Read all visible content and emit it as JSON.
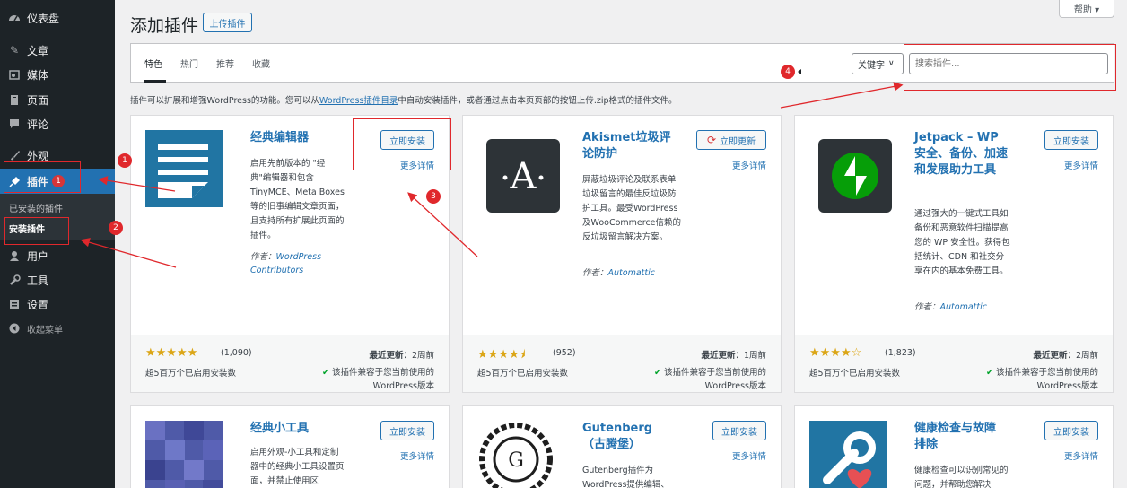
{
  "sidebar": {
    "items": [
      {
        "label": "仪表盘",
        "icon": "dashboard-icon"
      },
      {
        "label": "文章",
        "icon": "pin-icon"
      },
      {
        "label": "媒体",
        "icon": "media-icon"
      },
      {
        "label": "页面",
        "icon": "page-icon"
      },
      {
        "label": "评论",
        "icon": "comment-icon"
      },
      {
        "label": "外观",
        "icon": "brush-icon"
      },
      {
        "label": "插件",
        "icon": "plugin-icon"
      },
      {
        "label": "用户",
        "icon": "user-icon"
      },
      {
        "label": "工具",
        "icon": "wrench-icon"
      },
      {
        "label": "设置",
        "icon": "settings-icon"
      },
      {
        "label": "收起菜单",
        "icon": "collapse-icon"
      }
    ],
    "sub_items": [
      {
        "label": "已安装的插件"
      },
      {
        "label": "安装插件"
      }
    ]
  },
  "header": {
    "title": "添加插件",
    "upload_label": "上传插件",
    "help_label": "帮助 ▾"
  },
  "filters": {
    "tabs": [
      "特色",
      "热门",
      "推荐",
      "收藏"
    ],
    "keyword_label": "关键字",
    "search_placeholder": "搜索插件..."
  },
  "intro": {
    "before": "插件可以扩展和增强WordPress的功能。您可以从",
    "link": "WordPress插件目录",
    "after": "中自动安装插件，或者通过点击本页页部的按钮上传.zip格式的插件文件。"
  },
  "cards": [
    {
      "name": "经典编辑器",
      "button": "立即安装",
      "more": "更多详情",
      "desc": "启用先前版本的 \"经典\"编辑器和包含TinyMCE、Meta Boxes等的旧事编辑文章页面，且支持所有扩展此页面的插件。",
      "author_prefix": "作者：",
      "author": "WordPress Contributors",
      "stars": "★★★★★",
      "rating_count": "(1,090)",
      "installs": "超5百万个已启用安装数",
      "updated_label": "最近更新：",
      "updated": "2周前",
      "compat_check": "✔",
      "compat_strong": "该插件兼容于您当前使用的",
      "compat_rest": "WordPress版本"
    },
    {
      "name": "Akismet垃圾评论防护",
      "button": "立即更新",
      "more": "更多详情",
      "desc": "屏蔽垃圾评论及联系表单垃圾留言的最佳反垃圾防护工具。最受WordPress及WooCommerce信赖的反垃圾留言解决方案。",
      "author_prefix": "作者：",
      "author": "Automattic",
      "stars": "★★★★⯨",
      "rating_count": "(952)",
      "installs": "超5百万个已启用安装数",
      "updated_label": "最近更新：",
      "updated": "1周前",
      "compat_check": "✔",
      "compat_strong": "该插件兼容于您当前使用的",
      "compat_rest": "WordPress版本"
    },
    {
      "name": "Jetpack – WP 安全、备份、加速和发展助力工具",
      "button": "立即安装",
      "more": "更多详情",
      "desc": "通过强大的一键式工具如备份和恶意软件扫描提高您的 WP 安全性。获得包括统计、CDN 和社交分享在内的基本免费工具。",
      "author_prefix": "作者：",
      "author": "Automattic",
      "stars": "★★★★☆",
      "rating_count": "(1,823)",
      "installs": "超5百万个已启用安装数",
      "updated_label": "最近更新：",
      "updated": "2周前",
      "compat_check": "✔",
      "compat_strong": "该插件兼容于您当前使用的",
      "compat_rest": "WordPress版本"
    },
    {
      "name": "经典小工具",
      "button": "立即安装",
      "more": "更多详情",
      "desc": "启用外观-小工具和定制器中的经典小工具设置页面，并禁止使用区"
    },
    {
      "name": "Gutenberg（古腾堡）",
      "button": "立即安装",
      "more": "更多详情",
      "desc": "Gutenberg插件为WordPress提供编辑、"
    },
    {
      "name": "健康检查与故障排除",
      "button": "立即安装",
      "more": "更多详情",
      "desc": "健康检查可以识别常见的问题，并帮助您解决"
    }
  ],
  "annotations": [
    "1",
    "1",
    "2",
    "3",
    "4"
  ],
  "colors": {
    "accent": "#2271b1",
    "sidebar": "#1d2327",
    "annotation": "#e0282c",
    "star": "#dba617"
  }
}
